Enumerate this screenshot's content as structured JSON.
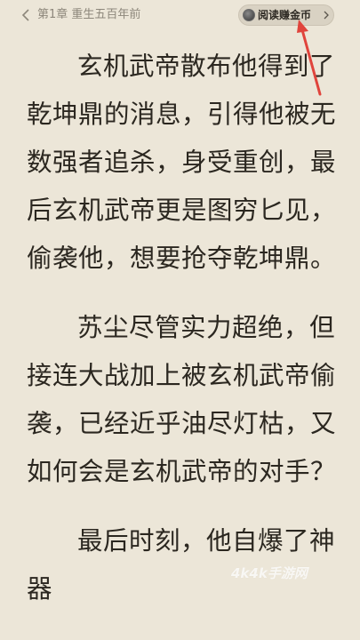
{
  "header": {
    "back_icon": "chevron-left-icon",
    "chapter_title": "第1章 重生五百年前",
    "reward_button": {
      "icon": "coin-icon",
      "label": "阅读赚金币",
      "chevron": "chevron-right-icon"
    }
  },
  "annotation": {
    "arrow_color": "#e0443c"
  },
  "content": {
    "paragraphs": [
      "玄机武帝散布他得到了乾坤鼎的消息，引得他被无数强者追杀，身受重创，最后玄机武帝更是图穷匕见，偷袭他，想要抢夺乾坤鼎。",
      "苏尘尽管实力超绝，但接连大战加上被玄机武帝偷袭，已经近乎油尽灯枯，又如何会是玄机武帝的对手？",
      "最后时刻，他自爆了神器"
    ]
  },
  "watermark": "4k4k手游网"
}
